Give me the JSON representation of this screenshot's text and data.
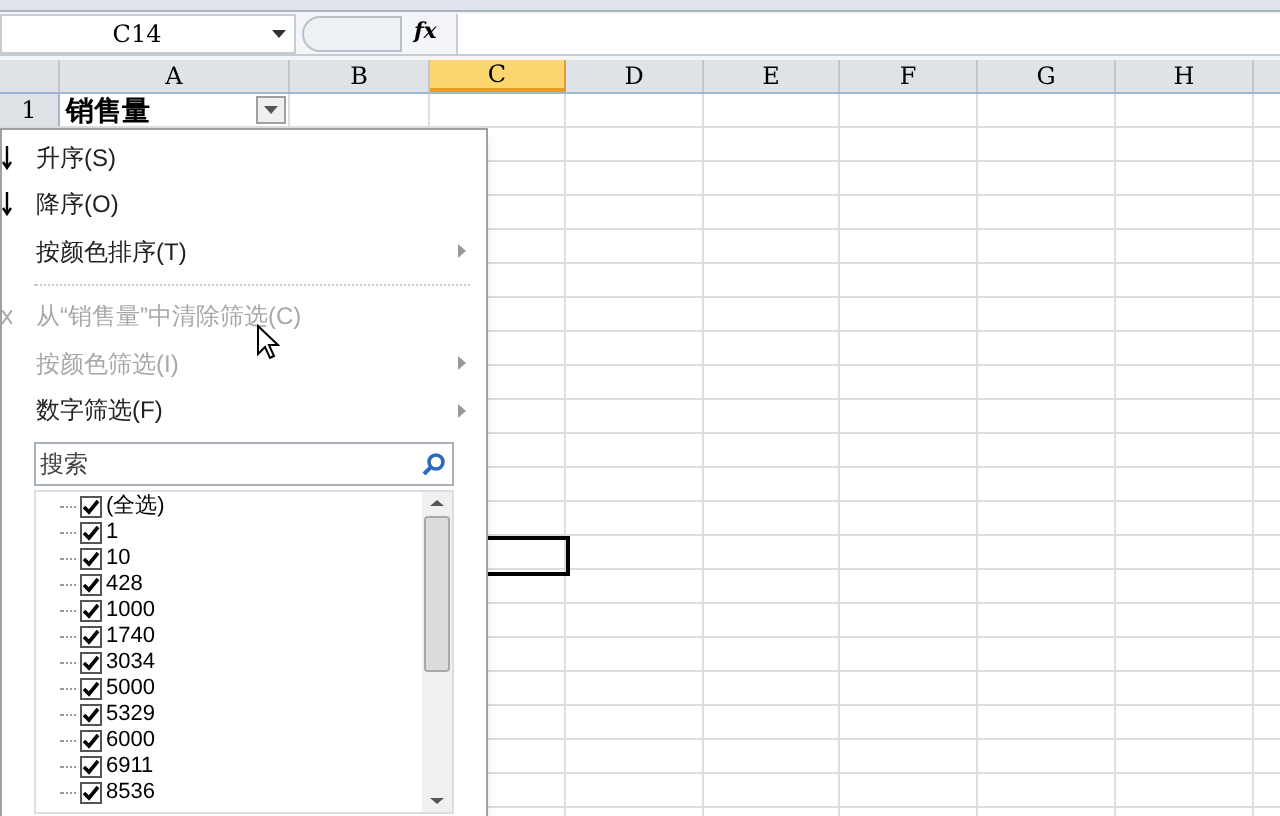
{
  "name_box": {
    "value": "C14"
  },
  "formula_bar": {
    "fx_label": "fx"
  },
  "columns": [
    {
      "label": "A",
      "selected": false
    },
    {
      "label": "B",
      "selected": false
    },
    {
      "label": "C",
      "selected": true
    },
    {
      "label": "D",
      "selected": false
    },
    {
      "label": "E",
      "selected": false
    },
    {
      "label": "F",
      "selected": false
    },
    {
      "label": "G",
      "selected": false
    },
    {
      "label": "H",
      "selected": false
    }
  ],
  "rows": [
    {
      "header": "1",
      "cell_a": "销售量",
      "filter_button": true
    }
  ],
  "filter_menu": {
    "items": [
      {
        "kind": "sort",
        "label": "升序(S)",
        "disabled": false,
        "has_submenu": false
      },
      {
        "kind": "sort",
        "label": "降序(O)",
        "disabled": false,
        "has_submenu": false
      },
      {
        "kind": "item",
        "label": "按颜色排序(T)",
        "disabled": false,
        "has_submenu": true
      },
      {
        "kind": "separator"
      },
      {
        "kind": "clear",
        "label": "从“销售量”中清除筛选(C)",
        "disabled": true,
        "has_submenu": false
      },
      {
        "kind": "item",
        "label": "按颜色筛选(I)",
        "disabled": true,
        "has_submenu": true
      },
      {
        "kind": "item",
        "label": "数字筛选(F)",
        "disabled": false,
        "has_submenu": true
      }
    ],
    "search": {
      "placeholder": "搜索"
    },
    "values": [
      {
        "label": "(全选)",
        "checked": true
      },
      {
        "label": "1",
        "checked": true
      },
      {
        "label": "10",
        "checked": true
      },
      {
        "label": "428",
        "checked": true
      },
      {
        "label": "1000",
        "checked": true
      },
      {
        "label": "1740",
        "checked": true
      },
      {
        "label": "3034",
        "checked": true
      },
      {
        "label": "5000",
        "checked": true
      },
      {
        "label": "5329",
        "checked": true
      },
      {
        "label": "6000",
        "checked": true
      },
      {
        "label": "6911",
        "checked": true
      },
      {
        "label": "8536",
        "checked": true
      }
    ]
  }
}
